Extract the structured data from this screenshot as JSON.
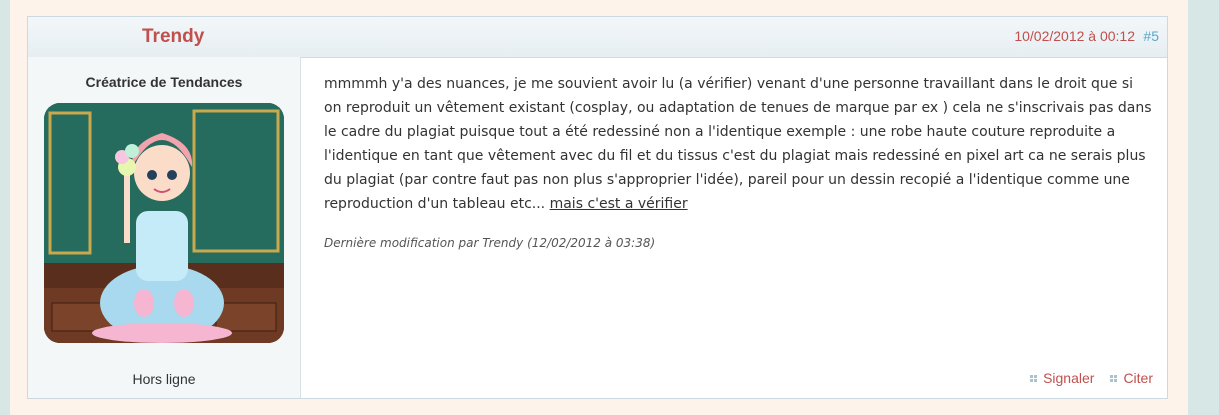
{
  "post": {
    "author": "Trendy",
    "date": "10/02/2012 à 00:12",
    "number": "#5",
    "author_title": "Créatrice de Tendances",
    "status": "Hors ligne",
    "body": "mmmmh y'a des nuances, je me souvient avoir lu (a vérifier) venant d'une personne travaillant dans le droit que si on  reproduit un vêtement existant (cosplay, ou adaptation de tenues de marque par ex ) cela ne s'inscrivais pas dans le cadre du plagiat puisque tout a été redessiné non a l'identique exemple : une robe haute couture reproduite a l'identique en tant que vêtement avec du fil et du tissus c'est du plagiat mais redessiné en pixel art ca ne serais plus du plagiat (par contre faut pas non plus s'approprier l'idée), pareil pour un dessin recopié a l'identique comme une reproduction d'un tableau etc... ",
    "body_link": "mais c'est a vérifier",
    "edit_note": "Dernière modification par Trendy (12/02/2012 à 03:38)",
    "report_label": "Signaler",
    "quote_label": "Citer"
  },
  "colors": {
    "accent": "#c0504d",
    "post_number": "#5aa8c8",
    "page_background": "#fdf3ea"
  },
  "icons": {
    "action_icon": "grid-dots-icon"
  }
}
